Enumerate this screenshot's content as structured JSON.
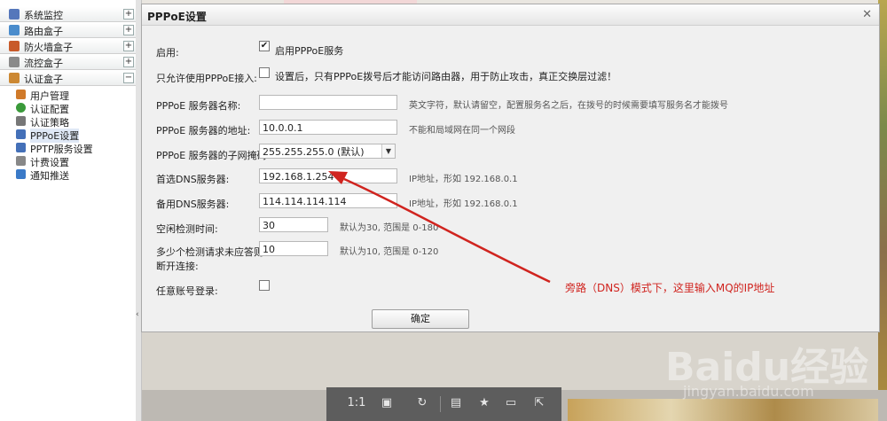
{
  "sidebar": {
    "groups": [
      {
        "label": "系统监控",
        "toggle": "+",
        "icon_color": "#5577bb"
      },
      {
        "label": "路由盒子",
        "toggle": "+",
        "icon_color": "#4a8ccc"
      },
      {
        "label": "防火墙盒子",
        "toggle": "+",
        "icon_color": "#c85a2a"
      },
      {
        "label": "流控盒子",
        "toggle": "+",
        "icon_color": "#8a8a8a"
      },
      {
        "label": "认证盒子",
        "toggle": "−",
        "icon_color": "#cc8833"
      }
    ],
    "items": [
      {
        "label": "用户管理",
        "icon_color": "#d07a2a"
      },
      {
        "label": "认证配置",
        "icon_color": "#3a9a3a"
      },
      {
        "label": "认证策略",
        "icon_color": "#777777"
      },
      {
        "label": "PPPoE设置",
        "icon_color": "#4470b8"
      },
      {
        "label": "PPTP服务设置",
        "icon_color": "#4470b8"
      },
      {
        "label": "计费设置",
        "icon_color": "#888888"
      },
      {
        "label": "通知推送",
        "icon_color": "#3a7ac8"
      }
    ]
  },
  "dialog": {
    "title": "PPPoE设置",
    "close": "✕",
    "enable": {
      "label": "启用:",
      "checked": "✔",
      "text": "启用PPPoE服务"
    },
    "restrict": {
      "label": "只允许使用PPPoE接入:",
      "text": "设置后，只有PPPoE拨号后才能访问路由器，用于防止攻击，真正交换层过滤！"
    },
    "server_name": {
      "label": "PPPoE 服务器名称:",
      "value": "",
      "hint": "英文字符，默认请留空，配置服务名之后，在拨号的时候需要填写服务名才能拨号"
    },
    "server_addr": {
      "label": "PPPoE 服务器的地址:",
      "value": "10.0.0.1",
      "hint": "不能和局域网在同一个网段"
    },
    "subnet": {
      "label": "PPPoE 服务器的子网掩码:",
      "value": "255.255.255.0 (默认)"
    },
    "dns1": {
      "label": "首选DNS服务器:",
      "value": "192.168.1.254",
      "hint": "IP地址，形如 192.168.0.1"
    },
    "dns2": {
      "label": "备用DNS服务器:",
      "value": "114.114.114.114",
      "hint": "IP地址，形如 192.168.0.1"
    },
    "idle": {
      "label": "空闲检测时间:",
      "value": "30",
      "hint": "默认为30, 范围是 0-180"
    },
    "retry": {
      "label1": "多少个检测请求未应答则",
      "label2": "断开连接:",
      "value": "10",
      "hint": "默认为10, 范围是 0-120"
    },
    "any_login": {
      "label": "任意账号登录:"
    },
    "ok_button": "确定"
  },
  "annotation": {
    "text": "旁路（DNS）模式下，这里输入MQ的IP地址",
    "color": "#d0241f"
  },
  "viewer": {
    "zoom": "1:1"
  },
  "watermark": {
    "main": "Baidu经验",
    "sub": "jingyan.baidu.com"
  }
}
